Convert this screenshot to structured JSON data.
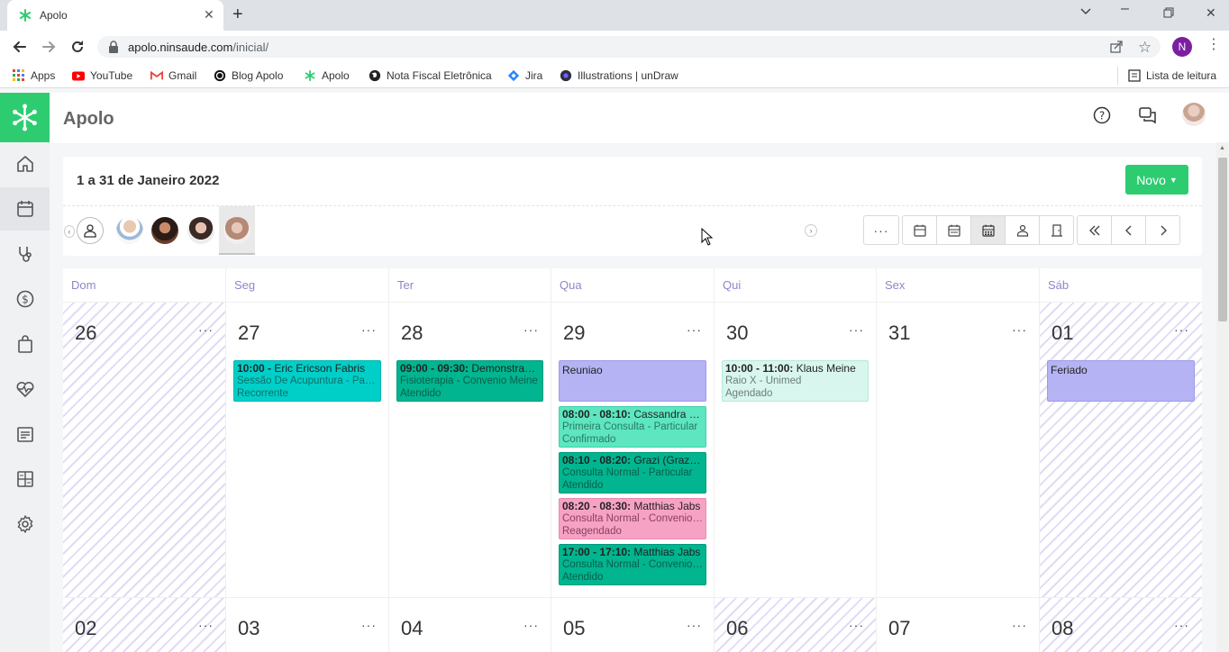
{
  "browser": {
    "tab_title": "Apolo",
    "url_host": "apolo.ninsaude.com",
    "url_path": "/inicial/",
    "profile_initial": "N",
    "bookmarks": [
      "Apps",
      "YouTube",
      "Gmail",
      "Blog Apolo",
      "Apolo",
      "Nota Fiscal Eletrônica",
      "Jira",
      "Illustrations | unDraw"
    ],
    "reading_list": "Lista de leitura"
  },
  "app": {
    "title": "Apolo",
    "period": "1 a 31 de Janeiro 2022",
    "new_button": "Novo",
    "accent": "#2ecc71"
  },
  "calendar": {
    "weekdays": [
      "Dom",
      "Seg",
      "Ter",
      "Qua",
      "Qui",
      "Sex",
      "Sáb"
    ],
    "week1_days": [
      "26",
      "27",
      "28",
      "29",
      "30",
      "31",
      "01"
    ],
    "week2_days": [
      "02",
      "03",
      "04",
      "05",
      "06",
      "07",
      "08"
    ],
    "more": "···",
    "events": {
      "mon": {
        "time": "10:00 -",
        "name": " Eric Ericson Fabris",
        "detail": "Sessão De Acupuntura - Particular",
        "status": "Recorrente",
        "color": "#00cfc8"
      },
      "tue": {
        "time": "09:00 - 09:30:",
        "name": " Demonstração",
        "detail": "Fisioterapia - Convenio Meine",
        "status": "Atendido",
        "color": "#00b58f"
      },
      "wed0": {
        "title": "Reuniao",
        "color": "#b5b3f3"
      },
      "wed1": {
        "time": "08:00 - 08:10:",
        "name": " Cassandra Pereira",
        "detail": "Primeira Consulta - Particular",
        "status": "Confirmado",
        "color": "#5de6c0"
      },
      "wed2": {
        "time": "08:10 - 08:20:",
        "name": " Grazi (Graziela)",
        "detail": "Consulta Normal - Particular",
        "status": "Atendido",
        "color": "#00b58f"
      },
      "wed3": {
        "time": "08:20 - 08:30:",
        "name": " Matthias Jabs",
        "detail": "Consulta Normal - Convenio Meine",
        "status": "Reagendado",
        "color": "#f6a2c4"
      },
      "wed4": {
        "time": "17:00 - 17:10:",
        "name": " Matthias Jabs",
        "detail": "Consulta Normal - Convenio Meine",
        "status": "Atendido",
        "color": "#00b58f"
      },
      "thu": {
        "time": "10:00 - 11:00:",
        "name": " Klaus Meine",
        "detail": "Raio X - Unimed",
        "status": "Agendado",
        "color": "#d8f6ee"
      },
      "sat": {
        "title": "Feriado",
        "color": "#b5b3f3"
      }
    }
  }
}
